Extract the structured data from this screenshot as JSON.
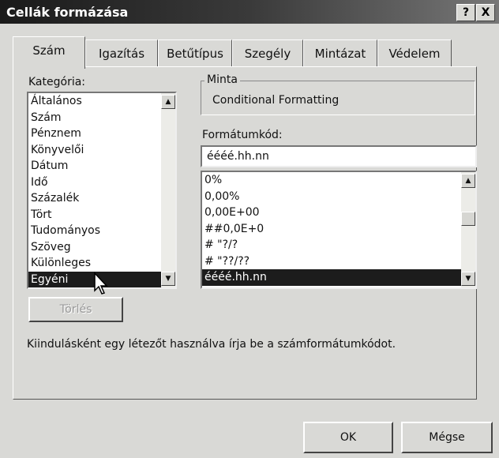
{
  "window": {
    "title": "Cellák formázása",
    "help_button": "?",
    "close_button": "X"
  },
  "tabs": [
    {
      "label": "Szám",
      "active": true
    },
    {
      "label": "Igazítás"
    },
    {
      "label": "Betűtípus"
    },
    {
      "label": "Szegély"
    },
    {
      "label": "Mintázat"
    },
    {
      "label": "Védelem"
    }
  ],
  "category": {
    "label": "Kategória:",
    "items": [
      "Általános",
      "Szám",
      "Pénznem",
      "Könyvelői",
      "Dátum",
      "Idő",
      "Százalék",
      "Tört",
      "Tudományos",
      "Szöveg",
      "Különleges",
      "Egyéni"
    ],
    "selected": "Egyéni"
  },
  "sample": {
    "label": "Minta",
    "value": "Conditional Formatting"
  },
  "format_code": {
    "label": "Formátumkód:",
    "value": "éééé.hh.nn",
    "items": [
      "0%",
      "0,00%",
      "0,00E+00",
      "##0,0E+0",
      "# \"?/?",
      "# \"??/??",
      "éééé.hh.nn"
    ],
    "selected": "éééé.hh.nn"
  },
  "delete_button": "Törlés",
  "description": "Kiindulásként egy létezőt használva írja be a számformátumkódot.",
  "ok_button": "OK",
  "cancel_button": "Mégse",
  "icons": {
    "arrow_up": "▲",
    "arrow_down": "▼"
  }
}
